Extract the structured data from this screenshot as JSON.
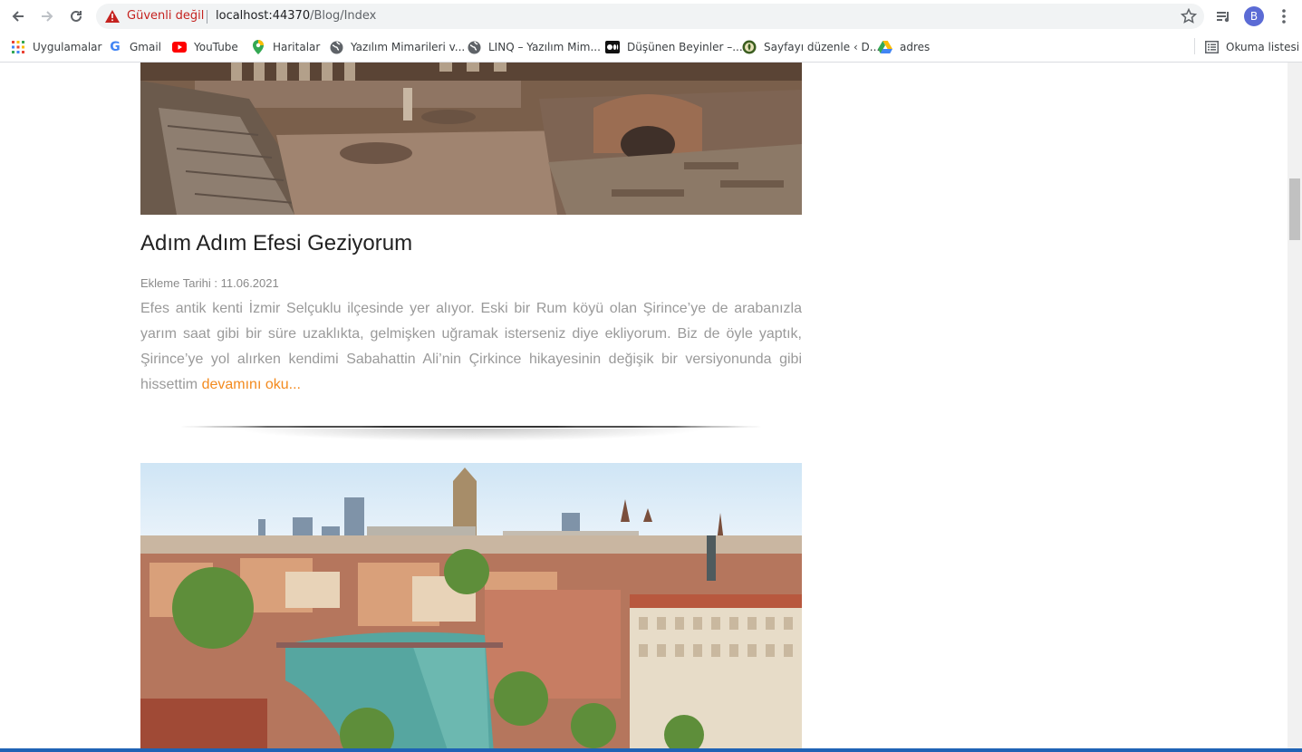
{
  "browser": {
    "security_label": "Güvenli değil",
    "url_host": "localhost:44370",
    "url_path": "/Blog/Index",
    "profile_initial": "B"
  },
  "bookmarks": [
    {
      "label": "Uygulamalar",
      "icon": "apps-grid-icon"
    },
    {
      "label": "Gmail",
      "icon": "google-icon"
    },
    {
      "label": "YouTube",
      "icon": "youtube-icon"
    },
    {
      "label": "Haritalar",
      "icon": "maps-pin-icon"
    },
    {
      "label": "Yazılım Mimarileri v...",
      "icon": "globe-icon"
    },
    {
      "label": "LINQ – Yazılım Mim...",
      "icon": "globe-icon"
    },
    {
      "label": "Düşünen Beyinler –...",
      "icon": "medium-icon"
    },
    {
      "label": "Sayfayı düzenle ‹ D...",
      "icon": "site-logo-icon"
    },
    {
      "label": "adres",
      "icon": "drive-icon"
    }
  ],
  "reading_list_label": "Okuma listesi",
  "posts": [
    {
      "title": "Adım Adım Efesi Geziyorum",
      "date": "Ekleme Tarihi : 11.06.2021",
      "excerpt": "Efes antik kenti İzmir Selçuklu ilçesinde yer alıyor. Eski bir Rum köyü olan Şirince’ye de arabanızla yarım saat gibi bir süre uzaklıkta, gelmişken uğramak isterseniz diye ekliyorum. Biz de öyle yaptık, Şirince’ye yol alırken kendimi Sabahattin Ali’nin Çirkince hikayesinin değişik bir versiyonunda gibi hissettim",
      "read_more": "devamını oku..."
    }
  ],
  "colors": {
    "accent": "#f38a1e",
    "warning": "#c5221f",
    "text_muted": "#9a9a9a"
  }
}
